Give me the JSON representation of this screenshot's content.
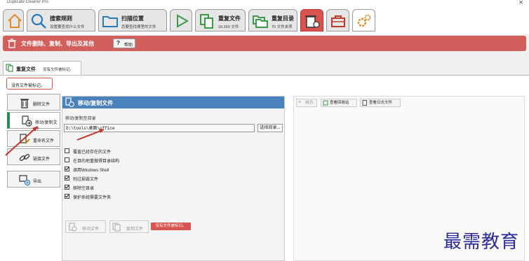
{
  "app": {
    "title": "Duplicate Cleaner Pro",
    "close_glyph": "✕"
  },
  "toolbar": {
    "tabs": [
      {
        "id": "home",
        "icon": "home-icon"
      },
      {
        "id": "search",
        "icon": "search-icon",
        "label": "搜索规则",
        "sub": "设置要查找什么文件"
      },
      {
        "id": "scan",
        "icon": "folder-icon",
        "label": "扫描位置",
        "sub": "您要查找哪里的文件"
      },
      {
        "id": "start",
        "icon": "play-icon"
      },
      {
        "id": "dupfiles",
        "icon": "duplicate-files-icon",
        "label": "重复文件",
        "sub": "18,369 文件"
      },
      {
        "id": "dupfolders",
        "icon": "duplicate-folders-icon",
        "label": "重复目录",
        "sub": "70 文件夹项"
      },
      {
        "id": "remove",
        "icon": "trash-arrow-icon"
      },
      {
        "id": "toolbox",
        "icon": "toolbox-icon"
      },
      {
        "id": "settings",
        "icon": "gears-icon"
      }
    ]
  },
  "section": {
    "title": "文件删除、复制、导出及其他",
    "help_label": "帮助"
  },
  "subtab": {
    "label": "重复文件",
    "note": "没有文件被标记。"
  },
  "no_marked": "没有文件被标记。",
  "sidebar": {
    "items": [
      {
        "label": "删除文件",
        "icon": "trash-icon"
      },
      {
        "label": "移动/复制文件",
        "icon": "move-copy-icon"
      },
      {
        "label": "重命名文件",
        "icon": "rename-icon"
      },
      {
        "label": "链接文件",
        "icon": "link-icon"
      },
      {
        "label": "导出",
        "icon": "export-icon"
      }
    ]
  },
  "move_panel": {
    "title": "移动/复制文件",
    "dest_label": "移动/复制至目录",
    "dest_value": "D:\\tools\\桌面\\office",
    "browse_label": "选择目录...",
    "options": [
      {
        "label": "覆盖已经存在的文件",
        "checked": false
      },
      {
        "label": "在目的地重做得目录结构",
        "checked": false
      },
      {
        "label": "调用Windows Shell",
        "checked": true
      },
      {
        "label": "则过损毁文件",
        "checked": true
      },
      {
        "label": "移除空目录",
        "checked": true
      },
      {
        "label": "保护系统需要文件夹",
        "checked": true
      }
    ],
    "move_button": "移动文件",
    "copy_button": "复制文件",
    "status": "没有文件被标记。"
  },
  "right_panel": {
    "undo_label": "撤消",
    "recycle_label": "查看回收站",
    "log_label": "查看日志文件"
  },
  "watermark": "最需教育",
  "colors": {
    "accent_red": "#d25f5b",
    "panel_blue": "#4a83bc",
    "active_green": "#2a8a5a"
  }
}
